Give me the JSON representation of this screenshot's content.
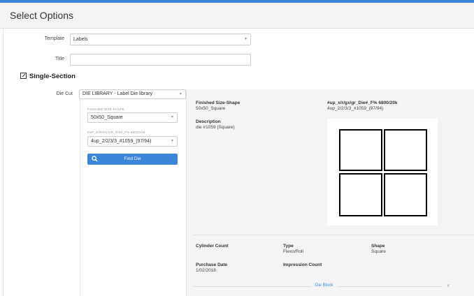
{
  "header": {
    "title": "Select Options"
  },
  "form": {
    "template_label": "Template",
    "template_value": "Labels",
    "title_label": "Title",
    "title_value": ""
  },
  "section": {
    "title": "Single-Section"
  },
  "diecut": {
    "label": "Die Cut",
    "library_value": "DIE LIBRARY - Label Die library",
    "finished_size_label": "FINISHED SIZE-SHAPE",
    "finished_size_value": "50x50_Square",
    "die_label": "#UP_X/R/GX/GR_DIE#_F% 6800/20K",
    "die_value": "4up_2/2/3/3_#1059_(97/94)",
    "find_button": "Find Die"
  },
  "details": {
    "finished_size_label": "Finished Size-Shape",
    "finished_size_value": "50x50_Square",
    "die_label": "#up_x/r/gx/gr_Die#_F% 6800/20k",
    "die_value": "4up_2/2/3/3_#1059_(97/94)",
    "description_label": "Description",
    "description_value": "die #1059 (Square)",
    "cylinder_count_label": "Cylinder Count",
    "cylinder_count_value": "",
    "type_label": "Type",
    "type_value": "Flexo/Roll",
    "shape_label": "Shape",
    "shape_value": "Square",
    "purchase_date_label": "Purchase Date",
    "purchase_date_value": "1/02/2018",
    "impression_count_label": "Impression Count",
    "impression_count_value": "",
    "die_block_link": "Die Block"
  },
  "colors": {
    "accent": "#3b86d6",
    "panel": "#f4f4f4"
  }
}
